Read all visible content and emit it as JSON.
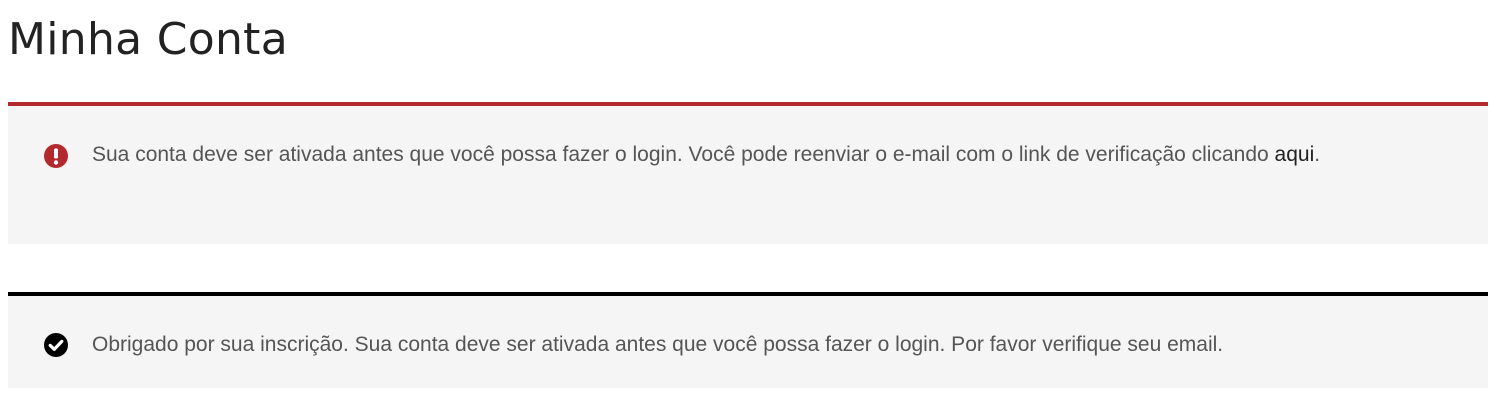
{
  "page": {
    "title": "Minha Conta"
  },
  "notices": {
    "error": {
      "icon": "exclamation-circle-icon",
      "color": "#b22a30",
      "text": "Sua conta deve ser ativada antes que você possa fazer o login. Você pode reenviar o e-mail com o link de verificação clicando ",
      "link_label": "aqui",
      "trailing": "."
    },
    "success": {
      "icon": "check-circle-icon",
      "color": "#000000",
      "text": "Obrigado por sua inscrição. Sua conta deve ser ativada antes que você possa fazer o login. Por favor verifique seu email."
    }
  }
}
